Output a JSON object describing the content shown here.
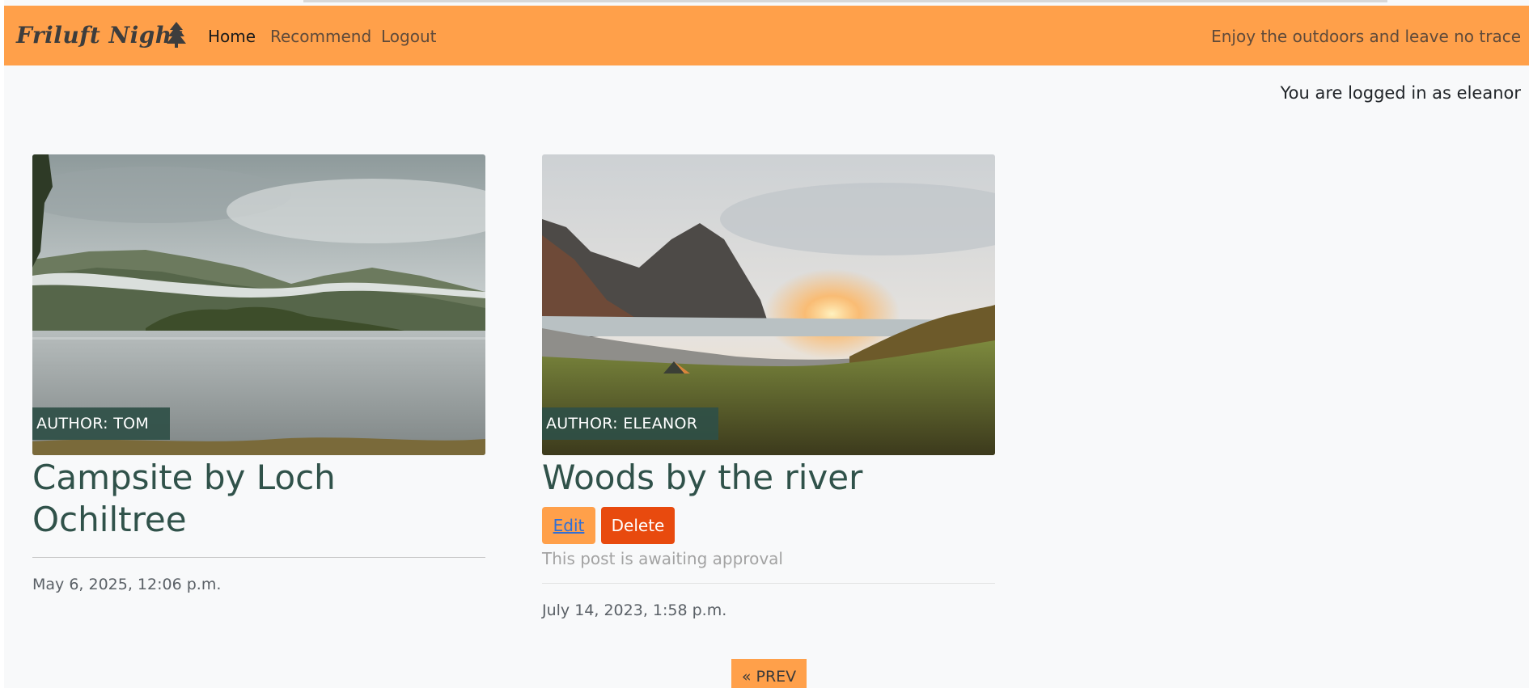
{
  "navbar": {
    "brand": "Friluft Night",
    "links": [
      {
        "label": "Home"
      },
      {
        "label": "Recommend"
      },
      {
        "label": "Logout"
      }
    ],
    "tagline": "Enjoy the outdoors and leave no trace"
  },
  "user": {
    "logged_in_text": "You are logged in as eleanor"
  },
  "posts": [
    {
      "author_badge": "AUTHOR: TOM",
      "title": "Campsite by Loch Ochiltree",
      "date": "May 6, 2025, 12:06 p.m."
    },
    {
      "author_badge": "AUTHOR: ELEANOR",
      "title": "Woods by the river",
      "edit_label": "Edit",
      "delete_label": "Delete",
      "status": "This post is awaiting approval",
      "date": "July 14, 2023, 1:58 p.m."
    }
  ],
  "pagination": {
    "prev_label": "« PREV"
  },
  "colors": {
    "navbar": "#ffa04a",
    "title": "#30524a",
    "delete": "#e84a0e",
    "badge": "#2f4f47"
  }
}
